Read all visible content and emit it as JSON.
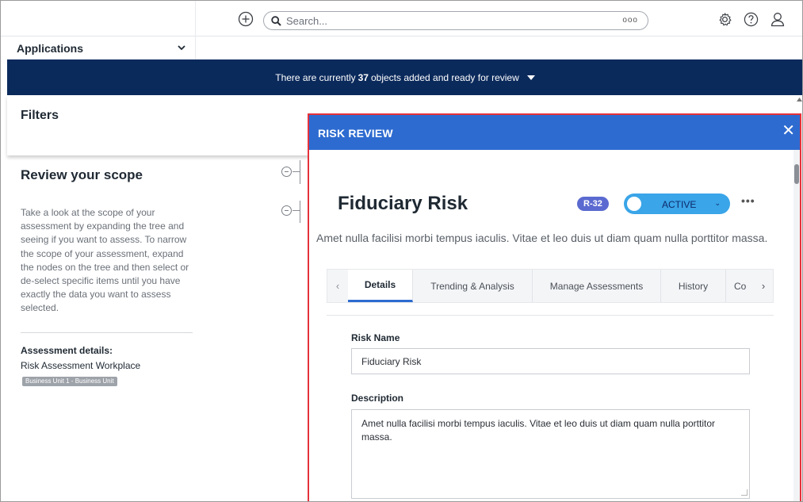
{
  "header": {
    "search_placeholder": "Search...",
    "more_label": "ooo"
  },
  "apps_menu": {
    "label": "Applications"
  },
  "banner": {
    "prefix": "There are currently",
    "count": "37",
    "suffix": "objects added and ready for review"
  },
  "left": {
    "filters_title": "Filters",
    "scope_title": "Review your scope",
    "scope_text": "Take a look at the scope of your assessment by expanding the tree and seeing if you want to assess. To narrow the scope of your assessment, expand the nodes on the tree and then select or de-select specific items until you have exactly the data you want to assess selected.",
    "details_label": "Assessment details:",
    "details_value": "Risk Assessment Workplace",
    "details_badge": "Business Unit 1 - Business Unit"
  },
  "modal": {
    "title": "RISK REVIEW",
    "close_label": "✕",
    "risk_name": "Fiduciary Risk",
    "risk_id": "R-32",
    "status": "ACTIVE",
    "description": "Amet nulla facilisi morbi tempus iaculis. Vitae et leo duis ut diam quam nulla porttitor massa.",
    "tabs": [
      "Details",
      "Trending & Analysis",
      "Manage Assessments",
      "History",
      "Co"
    ],
    "fields": {
      "risk_name_label": "Risk Name",
      "risk_name_value": "Fiduciary Risk",
      "description_label": "Description",
      "description_value": "Amet nulla facilisi morbi tempus iaculis. Vitae et leo duis ut diam quam nulla porttitor massa."
    }
  },
  "colors": {
    "banner": "#0b2a5c",
    "modal_header": "#2d6bd0",
    "modal_border": "#e5323b",
    "status": "#3aa5e8",
    "badge": "#5b6ad0"
  }
}
